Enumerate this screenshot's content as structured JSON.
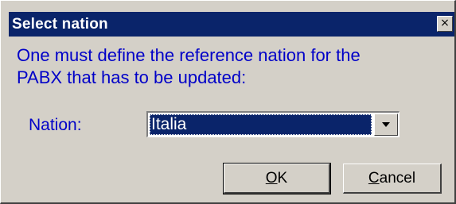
{
  "window": {
    "title": "Select nation",
    "close_glyph": "×"
  },
  "message": {
    "line1": "One must define the reference nation for the",
    "line2": "PABX that has to be updated:"
  },
  "nation": {
    "label": "Nation:",
    "selected": "Italia"
  },
  "buttons": {
    "ok_mnemonic": "O",
    "ok_rest": "K",
    "cancel_mnemonic": "C",
    "cancel_rest": "ancel"
  },
  "icons": {
    "close": "close-icon",
    "dropdown": "chevron-down-icon"
  },
  "colors": {
    "titlebar": "#0a246a",
    "dialog_bg": "#d4d0c8",
    "message_text": "#0000c8",
    "selection": "#0a246a"
  }
}
